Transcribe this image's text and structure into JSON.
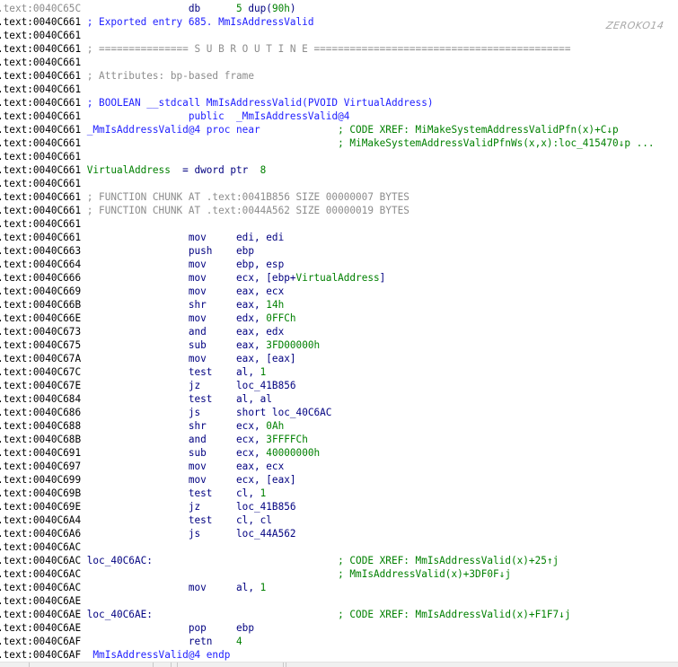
{
  "watermark": "ZEROKO14",
  "colors": {
    "mnemonic": "#000080",
    "name": "#2020ff",
    "comment_gray": "#8c8c8c",
    "number": "#008000"
  },
  "lines": [
    {
      "addr": ".text:0040C65C",
      "dim": true,
      "mnem": [
        "db",
        "navy"
      ],
      "ops": [
        [
          "5",
          "green"
        ],
        [
          " dup(",
          "navy"
        ],
        [
          "90h",
          "green"
        ],
        [
          ")",
          "navy"
        ]
      ]
    },
    {
      "addr": ".text:0040C661",
      "label": [
        [
          "; Exported entry 685. MmIsAddressValid",
          "blue"
        ]
      ]
    },
    {
      "addr": ".text:0040C661"
    },
    {
      "addr": ".text:0040C661",
      "label": [
        [
          "; =============== S U B R O U T I N E ===========================================",
          "gray"
        ]
      ]
    },
    {
      "addr": ".text:0040C661"
    },
    {
      "addr": ".text:0040C661",
      "label": [
        [
          "; Attributes: bp-based frame",
          "gray"
        ]
      ]
    },
    {
      "addr": ".text:0040C661"
    },
    {
      "addr": ".text:0040C661",
      "label": [
        [
          "; BOOLEAN __stdcall MmIsAddressValid(PVOID VirtualAddress)",
          "blue"
        ]
      ]
    },
    {
      "addr": ".text:0040C661",
      "mnem": [
        "public",
        "blue"
      ],
      "ops": [
        [
          "_MmIsAddressValid@4",
          "blue"
        ]
      ]
    },
    {
      "addr": ".text:0040C661",
      "label": [
        [
          "_MmIsAddressValid@4 proc near",
          "blue"
        ]
      ],
      "comment": [
        "; CODE XREF: MiMakeSystemAddressValidPfn(x)+C↓p",
        "green"
      ]
    },
    {
      "addr": ".text:0040C661",
      "comment": [
        "; MiMakeSystemAddressValidPfnWs(x,x):loc_415470↓p ...",
        "green"
      ]
    },
    {
      "addr": ".text:0040C661"
    },
    {
      "addr": ".text:0040C661",
      "label": [
        [
          "VirtualAddress",
          "green"
        ],
        [
          "  = dword ptr  ",
          "navy"
        ],
        [
          "8",
          "green"
        ]
      ]
    },
    {
      "addr": ".text:0040C661"
    },
    {
      "addr": ".text:0040C661",
      "label": [
        [
          "; FUNCTION CHUNK AT .text:0041B856 SIZE 00000007 BYTES",
          "gray"
        ]
      ]
    },
    {
      "addr": ".text:0040C661",
      "label": [
        [
          "; FUNCTION CHUNK AT .text:0044A562 SIZE 00000019 BYTES",
          "gray"
        ]
      ]
    },
    {
      "addr": ".text:0040C661"
    },
    {
      "addr": ".text:0040C661",
      "mnem": [
        "mov",
        "navy"
      ],
      "ops": [
        [
          "edi, edi",
          "navy"
        ]
      ]
    },
    {
      "addr": ".text:0040C663",
      "mnem": [
        "push",
        "navy"
      ],
      "ops": [
        [
          "ebp",
          "navy"
        ]
      ]
    },
    {
      "addr": ".text:0040C664",
      "mnem": [
        "mov",
        "navy"
      ],
      "ops": [
        [
          "ebp, esp",
          "navy"
        ]
      ]
    },
    {
      "addr": ".text:0040C666",
      "mnem": [
        "mov",
        "navy"
      ],
      "ops": [
        [
          "ecx, [ebp+",
          "navy"
        ],
        [
          "VirtualAddress",
          "green"
        ],
        [
          "]",
          "navy"
        ]
      ]
    },
    {
      "addr": ".text:0040C669",
      "mnem": [
        "mov",
        "navy"
      ],
      "ops": [
        [
          "eax, ecx",
          "navy"
        ]
      ]
    },
    {
      "addr": ".text:0040C66B",
      "mnem": [
        "shr",
        "navy"
      ],
      "ops": [
        [
          "eax, ",
          "navy"
        ],
        [
          "14h",
          "green"
        ]
      ]
    },
    {
      "addr": ".text:0040C66E",
      "mnem": [
        "mov",
        "navy"
      ],
      "ops": [
        [
          "edx, ",
          "navy"
        ],
        [
          "0FFCh",
          "green"
        ]
      ]
    },
    {
      "addr": ".text:0040C673",
      "mnem": [
        "and",
        "navy"
      ],
      "ops": [
        [
          "eax, edx",
          "navy"
        ]
      ]
    },
    {
      "addr": ".text:0040C675",
      "mnem": [
        "sub",
        "navy"
      ],
      "ops": [
        [
          "eax, ",
          "navy"
        ],
        [
          "3FD00000h",
          "green"
        ]
      ]
    },
    {
      "addr": ".text:0040C67A",
      "mnem": [
        "mov",
        "navy"
      ],
      "ops": [
        [
          "eax, [eax]",
          "navy"
        ]
      ]
    },
    {
      "addr": ".text:0040C67C",
      "mnem": [
        "test",
        "navy"
      ],
      "ops": [
        [
          "al, ",
          "navy"
        ],
        [
          "1",
          "green"
        ]
      ]
    },
    {
      "addr": ".text:0040C67E",
      "mnem": [
        "jz",
        "navy"
      ],
      "ops": [
        [
          "loc_41B856",
          "navy"
        ]
      ]
    },
    {
      "addr": ".text:0040C684",
      "mnem": [
        "test",
        "navy"
      ],
      "ops": [
        [
          "al, al",
          "navy"
        ]
      ]
    },
    {
      "addr": ".text:0040C686",
      "mnem": [
        "js",
        "navy"
      ],
      "ops": [
        [
          "short loc_40C6AC",
          "navy"
        ]
      ]
    },
    {
      "addr": ".text:0040C688",
      "mnem": [
        "shr",
        "navy"
      ],
      "ops": [
        [
          "ecx, ",
          "navy"
        ],
        [
          "0Ah",
          "green"
        ]
      ]
    },
    {
      "addr": ".text:0040C68B",
      "mnem": [
        "and",
        "navy"
      ],
      "ops": [
        [
          "ecx, ",
          "navy"
        ],
        [
          "3FFFFCh",
          "green"
        ]
      ]
    },
    {
      "addr": ".text:0040C691",
      "mnem": [
        "sub",
        "navy"
      ],
      "ops": [
        [
          "ecx, ",
          "navy"
        ],
        [
          "40000000h",
          "green"
        ]
      ]
    },
    {
      "addr": ".text:0040C697",
      "mnem": [
        "mov",
        "navy"
      ],
      "ops": [
        [
          "eax, ecx",
          "navy"
        ]
      ]
    },
    {
      "addr": ".text:0040C699",
      "mnem": [
        "mov",
        "navy"
      ],
      "ops": [
        [
          "ecx, [eax]",
          "navy"
        ]
      ]
    },
    {
      "addr": ".text:0040C69B",
      "mnem": [
        "test",
        "navy"
      ],
      "ops": [
        [
          "cl, ",
          "navy"
        ],
        [
          "1",
          "green"
        ]
      ]
    },
    {
      "addr": ".text:0040C69E",
      "mnem": [
        "jz",
        "navy"
      ],
      "ops": [
        [
          "loc_41B856",
          "navy"
        ]
      ]
    },
    {
      "addr": ".text:0040C6A4",
      "mnem": [
        "test",
        "navy"
      ],
      "ops": [
        [
          "cl, cl",
          "navy"
        ]
      ]
    },
    {
      "addr": ".text:0040C6A6",
      "mnem": [
        "js",
        "navy"
      ],
      "ops": [
        [
          "loc_44A562",
          "navy"
        ]
      ]
    },
    {
      "addr": ".text:0040C6AC"
    },
    {
      "addr": ".text:0040C6AC",
      "label": [
        [
          "loc_40C6AC:",
          "navy"
        ]
      ],
      "comment": [
        "; CODE XREF: MmIsAddressValid(x)+25↑j",
        "green"
      ]
    },
    {
      "addr": ".text:0040C6AC",
      "comment": [
        "; MmIsAddressValid(x)+3DF0F↓j",
        "green"
      ]
    },
    {
      "addr": ".text:0040C6AC",
      "mnem": [
        "mov",
        "navy"
      ],
      "ops": [
        [
          "al, ",
          "navy"
        ],
        [
          "1",
          "green"
        ]
      ]
    },
    {
      "addr": ".text:0040C6AE"
    },
    {
      "addr": ".text:0040C6AE",
      "label": [
        [
          "loc_40C6AE:",
          "navy"
        ]
      ],
      "comment": [
        "; CODE XREF: MmIsAddressValid(x)+F1F7↓j",
        "green"
      ]
    },
    {
      "addr": ".text:0040C6AE",
      "mnem": [
        "pop",
        "navy"
      ],
      "ops": [
        [
          "ebp",
          "navy"
        ]
      ]
    },
    {
      "addr": ".text:0040C6AF",
      "mnem": [
        "retn",
        "navy"
      ],
      "ops": [
        [
          "4",
          "green"
        ]
      ]
    },
    {
      "addr": ".text:0040C6AF",
      "label": [
        [
          " MmIsAddressValid@4 endp",
          "blue"
        ]
      ]
    }
  ]
}
